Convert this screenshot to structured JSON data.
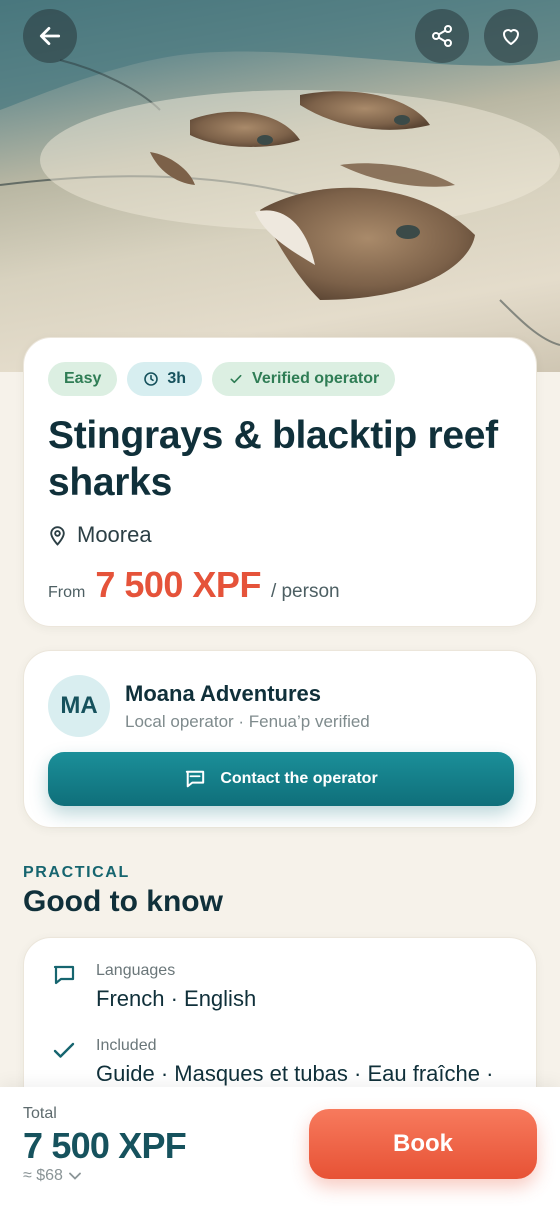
{
  "hero": {
    "image_subject": "stingrays in shallow water",
    "back_icon": "arrow-left-icon",
    "share_icon": "share-icon",
    "favorite_icon": "heart-icon"
  },
  "summary": {
    "chips": [
      {
        "label": "Easy",
        "icon": ""
      },
      {
        "label": "3h",
        "icon": "clock-icon"
      },
      {
        "label": "Verified operator",
        "icon": "check-icon"
      }
    ],
    "title": "Stingrays & blacktip reef sharks",
    "location": "Moorea",
    "price_prefix": "From",
    "price": "7 500 XPF",
    "price_suffix": "/ person"
  },
  "operator": {
    "initials": "MA",
    "name": "Moana Adventures",
    "subtitle": "Local operator · Fenua’p verified",
    "contact_label": "Contact the operator"
  },
  "practical": {
    "eyebrow": "PRACTICAL",
    "title": "Good to know",
    "items": [
      {
        "label": "Languages",
        "value": "French · English",
        "icon": "chat-icon"
      },
      {
        "label": "Included",
        "value": "Guide · Masques et tubas · Eau fraîche ·",
        "icon": "check-icon"
      }
    ]
  },
  "footer": {
    "total_label": "Total",
    "total_value": "7 500 XPF",
    "approx": "≈ $68",
    "book_label": "Book"
  },
  "colors": {
    "accent_teal": "#16525d",
    "price_red": "#e5533a",
    "book_orange": "#f06a4d",
    "background": "#f6f2ea"
  }
}
